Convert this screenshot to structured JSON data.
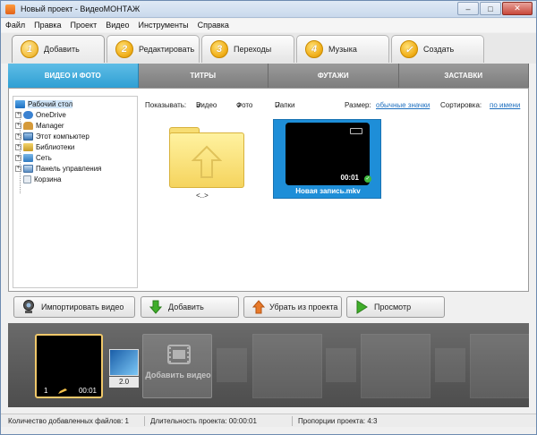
{
  "window": {
    "title": "Новый проект - ВидеоМОНТАЖ"
  },
  "menu": [
    "Файл",
    "Правка",
    "Проект",
    "Видео",
    "Инструменты",
    "Справка"
  ],
  "steps": [
    {
      "num": "1",
      "label": "Добавить",
      "active": true
    },
    {
      "num": "2",
      "label": "Редактировать"
    },
    {
      "num": "3",
      "label": "Переходы"
    },
    {
      "num": "4",
      "label": "Музыка"
    },
    {
      "num": "✓",
      "label": "Создать"
    }
  ],
  "subtabs": [
    "ВИДЕО И ФОТО",
    "ТИТРЫ",
    "ФУТАЖИ",
    "ЗАСТАВКИ"
  ],
  "tree": [
    {
      "label": "Рабочий стол",
      "icon": "desktop-icon",
      "selected": true
    },
    {
      "label": "OneDrive",
      "icon": "cloud-icon"
    },
    {
      "label": "Manager",
      "icon": "user-icon"
    },
    {
      "label": "Этот компьютер",
      "icon": "computer-icon"
    },
    {
      "label": "Библиотеки",
      "icon": "library-icon"
    },
    {
      "label": "Сеть",
      "icon": "network-icon"
    },
    {
      "label": "Панель управления",
      "icon": "control-panel-icon"
    },
    {
      "label": "Корзина",
      "icon": "trash-icon"
    }
  ],
  "filter": {
    "show_label": "Показывать:",
    "video": "Видео",
    "photo": "Фото",
    "folders": "Папки",
    "size_label": "Размер:",
    "size_value": "обычные значки",
    "sort_label": "Сортировка:",
    "sort_value": "по имени"
  },
  "files": {
    "up_label": "<..>",
    "video": {
      "name": "Новая запись.mkv",
      "duration": "00:01"
    }
  },
  "actions": {
    "import": "Импортировать видео",
    "add": "Добавить",
    "remove": "Убрать из проекта",
    "preview": "Просмотр"
  },
  "timeline": {
    "clip_index": "1",
    "clip_duration": "00:01",
    "transition_duration": "2.0",
    "add_video": "Добавить видео"
  },
  "status": {
    "files_count": "Количество добавленных файлов: 1",
    "duration": "Длительность проекта: 00:00:01",
    "aspect": "Пропорции проекта: 4:3"
  }
}
